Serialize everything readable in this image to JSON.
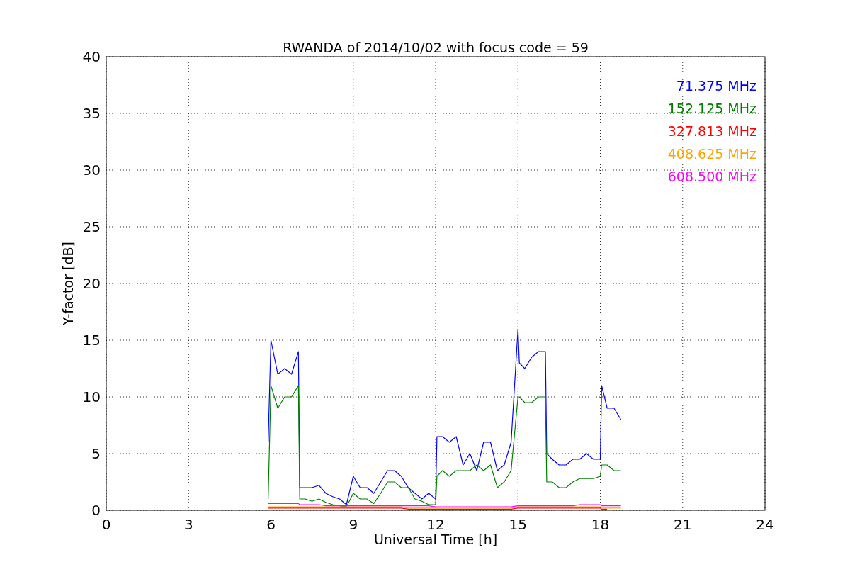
{
  "figure": {
    "chart_data": {
      "type": "line",
      "title": "RWANDA of 2014/10/02 with focus code = 59",
      "xlabel": "Universal Time [h]",
      "ylabel": "Y-factor [dB]",
      "x": [
        5.9,
        6.0,
        6.25,
        6.5,
        6.75,
        7.0,
        7.05,
        7.25,
        7.5,
        7.75,
        8.0,
        8.25,
        8.5,
        8.75,
        9.0,
        9.25,
        9.5,
        9.75,
        10.0,
        10.25,
        10.5,
        10.75,
        11.0,
        11.25,
        11.5,
        11.75,
        12.0,
        12.05,
        12.25,
        12.5,
        12.75,
        13.0,
        13.25,
        13.5,
        13.75,
        14.0,
        14.25,
        14.5,
        14.75,
        15.0,
        15.05,
        15.25,
        15.5,
        15.75,
        16.0,
        16.05,
        16.25,
        16.5,
        16.75,
        17.0,
        17.25,
        17.5,
        17.75,
        18.0,
        18.05,
        18.25,
        18.5,
        18.75
      ],
      "series": [
        {
          "name": "71.375 MHz",
          "color": "#0000ff",
          "values": [
            6,
            15,
            12,
            12.5,
            12,
            14,
            2,
            2,
            2,
            2.2,
            1.5,
            1.2,
            1,
            0.5,
            3,
            2,
            2,
            1.5,
            2.5,
            3.5,
            3.5,
            3,
            2,
            1.5,
            1,
            1.5,
            1,
            6.5,
            6.5,
            6,
            6.5,
            4,
            5,
            3.5,
            6,
            6,
            3.5,
            4,
            6,
            16,
            13,
            12.5,
            13.5,
            14,
            14,
            5,
            4.5,
            4,
            4,
            4.5,
            4.5,
            5,
            4.5,
            4.5,
            11,
            9,
            9,
            8
          ]
        },
        {
          "name": "152.125 MHz",
          "color": "#008000",
          "values": [
            1,
            11,
            9,
            10,
            10,
            11,
            1,
            1,
            0.8,
            1,
            0.7,
            0.5,
            0.4,
            0.3,
            1.5,
            1,
            1,
            0.6,
            1.5,
            2.5,
            2.5,
            2,
            2,
            1,
            0.8,
            0.5,
            0.5,
            3,
            3.5,
            3,
            3.5,
            3.5,
            3.5,
            4,
            3.5,
            4,
            2,
            2.5,
            3.5,
            10,
            10,
            9.5,
            9.5,
            10,
            10,
            2.5,
            2.5,
            2,
            2,
            2.5,
            2.8,
            2.8,
            2.8,
            3,
            4,
            4,
            3.5,
            3.5
          ]
        },
        {
          "name": "327.813 MHz",
          "color": "#ff0000",
          "values": [
            0.2,
            0.2,
            0.2,
            0.2,
            0.2,
            0.2,
            0.2,
            0.2,
            0.2,
            0.2,
            0.2,
            0.2,
            0.2,
            0.2,
            0.2,
            0.2,
            0.2,
            0.2,
            0.2,
            0.2,
            0.2,
            0.2,
            0.1,
            0.1,
            0.1,
            0.1,
            0.1,
            0.1,
            0.1,
            0.1,
            0.1,
            0.1,
            0.1,
            0.1,
            0.1,
            0.1,
            0.1,
            0.1,
            0.1,
            0.2,
            0.2,
            0.2,
            0.2,
            0.2,
            0.2,
            0.2,
            0.2,
            0.2,
            0.2,
            0.2,
            0.2,
            0.2,
            0.2,
            0.2,
            0.1,
            0.1,
            null,
            null
          ]
        },
        {
          "name": "408.625 MHz",
          "color": "#ffa500",
          "values": [
            0.3,
            0.3,
            0.3,
            0.3,
            0.3,
            0.3,
            0.3,
            0.3,
            0.3,
            0.3,
            0.3,
            0.3,
            0.3,
            0.3,
            0.3,
            0.3,
            0.3,
            0.3,
            0.3,
            0.3,
            0.3,
            0.3,
            0.2,
            0.2,
            0.2,
            0.2,
            0.2,
            0.2,
            0.2,
            0.2,
            0.2,
            0.2,
            0.2,
            0.2,
            0.2,
            0.2,
            0.2,
            0.2,
            0.2,
            0.3,
            0.3,
            0.3,
            0.3,
            0.3,
            0.3,
            0.3,
            0.3,
            0.3,
            0.3,
            0.3,
            0.3,
            0.3,
            0.3,
            0.3,
            0.2,
            0.2,
            0.2,
            0.2
          ]
        },
        {
          "name": "608.500 MHz",
          "color": "#ff00ff",
          "values": [
            0.6,
            0.6,
            0.6,
            0.6,
            0.6,
            0.6,
            0.5,
            0.5,
            0.5,
            0.5,
            0.4,
            0.4,
            0.4,
            0.4,
            0.4,
            0.4,
            0.4,
            0.4,
            0.4,
            0.4,
            0.4,
            0.4,
            0.4,
            0.4,
            0.4,
            0.4,
            0.3,
            0.3,
            0.3,
            0.3,
            0.3,
            0.3,
            0.3,
            0.3,
            0.3,
            0.3,
            0.3,
            0.3,
            0.3,
            0.4,
            0.4,
            0.4,
            0.4,
            0.4,
            0.4,
            0.4,
            0.4,
            0.4,
            0.4,
            0.4,
            0.5,
            0.5,
            0.5,
            0.5,
            0.4,
            0.4,
            0.4,
            0.4
          ]
        }
      ],
      "grid": true,
      "xlim": [
        0,
        24
      ],
      "ylim": [
        0,
        40
      ],
      "xticks": [
        0,
        3,
        6,
        9,
        12,
        15,
        18,
        21,
        24
      ],
      "yticks": [
        0,
        5,
        10,
        15,
        20,
        25,
        30,
        35,
        40
      ]
    }
  }
}
